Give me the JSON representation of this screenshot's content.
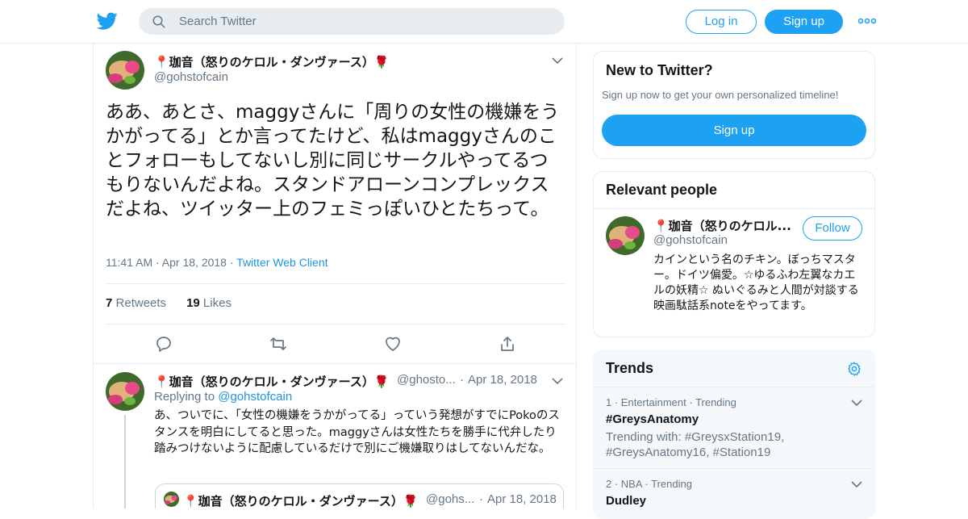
{
  "header": {
    "search_placeholder": "Search Twitter",
    "login_label": "Log in",
    "signup_label": "Sign up"
  },
  "tweet": {
    "author_name": "📍珈音（怒りのケロル・ダンヴァース）🌹",
    "author_handle": "@gohstofcain",
    "text": "ああ、あとさ、maggyさんに「周りの女性の機嫌をうかがってる」とか言ってたけど、私はmaggyさんのことフォローもしてないし別に同じサークルやってるつもりないんだよね。スタンドアローンコンプレックスだよね、ツイッター上のフェミっぽいひとたちって。",
    "time": "11:41 AM",
    "date": "Apr 18, 2018",
    "client": "Twitter Web Client",
    "retweets_count": "7",
    "retweets_label": "Retweets",
    "likes_count": "19",
    "likes_label": "Likes"
  },
  "reply": {
    "author_name": "📍珈音（怒りのケロル・ダンヴァース）🌹",
    "author_handle": "@ghosto...",
    "date": "Apr 18, 2018",
    "replying_to_label": "Replying to",
    "replying_to_handle": "@gohstofcain",
    "text": "あ、ついでに、「女性の機嫌をうかがってる」っていう発想がすでにPokoのスタンスを明白にしてると思った。maggyさんは女性たちを勝手に代弁したり踏みつけないように配慮しているだけで別にご機嫌取りはしてないんだな。"
  },
  "quoted": {
    "author_name": "📍珈音（怒りのケロル・ダンヴァース）🌹",
    "author_handle": "@gohs...",
    "date": "Apr 18, 2018"
  },
  "sidebar": {
    "new_title": "New to Twitter?",
    "new_subtitle": "Sign up now to get your own personalized timeline!",
    "signup_label": "Sign up",
    "relevant_title": "Relevant people",
    "person_name": "📍珈音（怒りのケロル...",
    "person_handle": "@gohstofcain",
    "follow_label": "Follow",
    "person_bio": "カインという名のチキン。ぼっちマスター。ドイツ偏愛。☆ゆるふわ左翼なカエルの妖精☆ ぬいぐるみと人間が対談する映画駄話系noteをやってます。",
    "trends_title": "Trends",
    "trends": [
      {
        "rank": "1",
        "category": "Entertainment",
        "status": "Trending",
        "name": "#GreysAnatomy",
        "with": "Trending with: #GreysxStation19, #GreysAnatomy16, #Station19"
      },
      {
        "rank": "2",
        "category": "NBA",
        "status": "Trending",
        "name": "Dudley",
        "with": ""
      }
    ]
  },
  "colors": {
    "accent": "#1da1f2",
    "link": "#1b95e0",
    "muted": "#657786",
    "border": "#e6ecf0"
  },
  "icons": [
    "twitter-bird-icon",
    "search-icon",
    "more-dots-icon",
    "chevron-down-icon",
    "reply-icon",
    "retweet-icon",
    "like-icon",
    "share-icon",
    "gear-icon"
  ]
}
